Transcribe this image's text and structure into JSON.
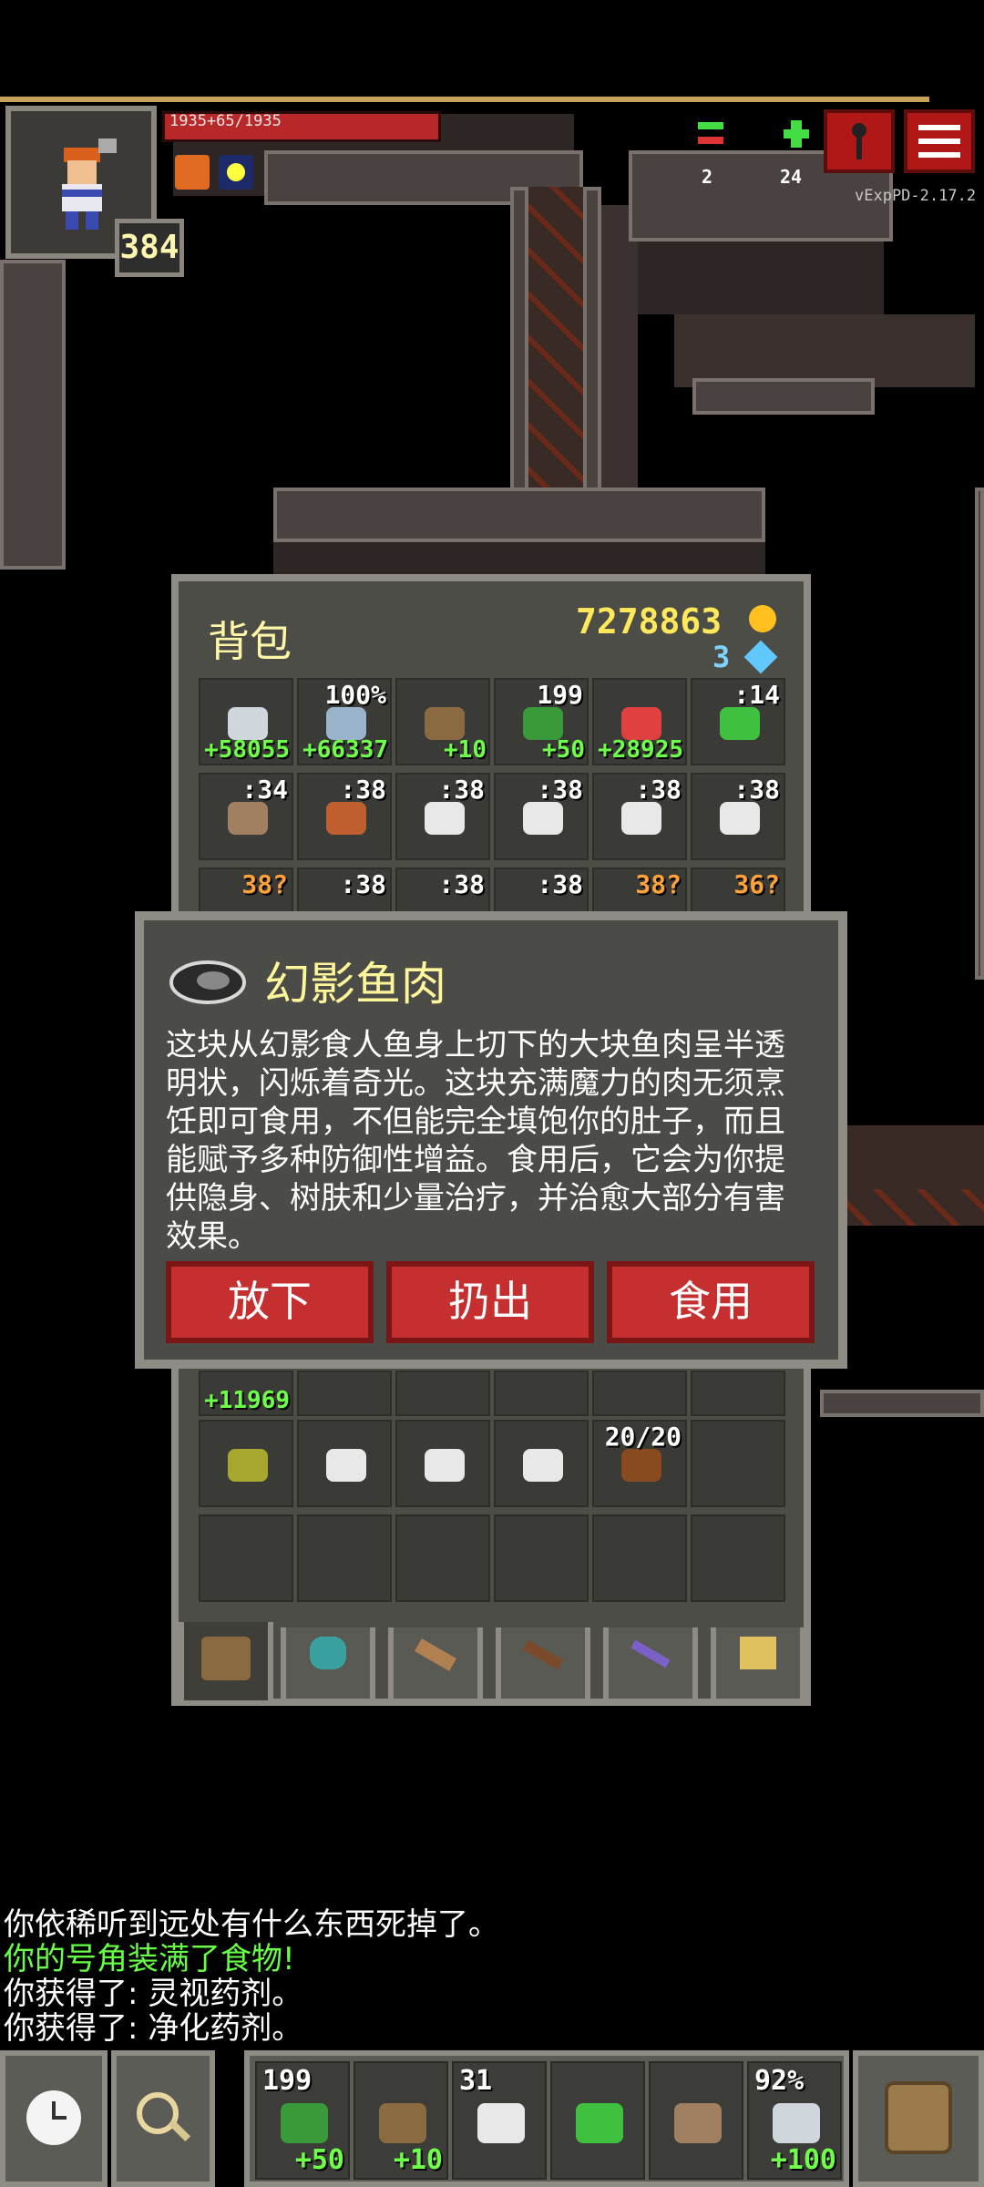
{
  "hud": {
    "hp_text": "1935+65/1935",
    "hp_fraction": 1.0,
    "level": "384",
    "journal_count": "2",
    "catalog_count": "24",
    "version": "vExpPD-2.17.2"
  },
  "inventory": {
    "title": "背包",
    "gold": "7278863",
    "gems": "3",
    "row1": [
      {
        "plus": "+58055",
        "icon": "sword-icon"
      },
      {
        "top": "100%",
        "plus": "+66337",
        "icon": "armor-icon"
      },
      {
        "plus": "+10",
        "icon": "spellbook-icon"
      },
      {
        "top": "199",
        "plus": "+50",
        "icon": "chain-whip-icon"
      },
      {
        "plus": "+28925",
        "icon": "ring-icon"
      },
      {
        "top": ":14",
        "icon": "wand-icon"
      }
    ],
    "row2": [
      {
        "top": ":34",
        "icon": "pickaxe-icon"
      },
      {
        "top": ":38",
        "icon": "staff-icon"
      },
      {
        "top": ":38",
        "icon": "potion-icon"
      },
      {
        "top": ":38",
        "icon": "potion-icon"
      },
      {
        "top": ":38",
        "icon": "potion-icon"
      },
      {
        "top": ":38",
        "icon": "potion-icon"
      }
    ],
    "row3": [
      {
        "q": "38?"
      },
      {
        "top": ":38"
      },
      {
        "top": ":38"
      },
      {
        "top": ":38"
      },
      {
        "q": "38?"
      },
      {
        "q": "36?"
      }
    ],
    "row4_plus": "+11969",
    "row5": [
      {
        "icon": "seed-pouch-icon"
      },
      {
        "icon": "fish-meat-icon"
      },
      {
        "icon": "fish-meat-icon"
      },
      {
        "icon": "fish-meat-icon"
      },
      {
        "top": "20/20",
        "icon": "horn-icon"
      }
    ]
  },
  "dialog": {
    "title": "幻影鱼肉",
    "description": "这块从幻影食人鱼身上切下的大块鱼肉呈半透明状，闪烁着奇光。这块充满魔力的肉无须烹饪即可食用，不但能完全填饱你的肚子，而且能赋予多种防御性增益。食用后，它会为你提供隐身、树肤和少量治疗，并治愈大部分有害效果。",
    "buttons": {
      "drop": "放下",
      "throw": "扔出",
      "eat": "食用"
    }
  },
  "log": [
    {
      "text": "你依稀听到远处有什么东西死掉了。",
      "color": "#ffffff"
    },
    {
      "text": "你的号角装满了食物!",
      "color": "#66ff44"
    },
    {
      "text": "你获得了: 灵视药剂。",
      "color": "#ffffff"
    },
    {
      "text": "你获得了: 净化药剂。",
      "color": "#ffffff"
    }
  ],
  "toolbar": {
    "quickslots": [
      {
        "top": "199",
        "plus": "+50",
        "icon": "chain-whip-icon"
      },
      {
        "plus": "+10",
        "icon": "spellbook-icon"
      },
      {
        "top": "31",
        "icon": "fish-meat-icon"
      },
      {
        "icon": "wand-icon"
      },
      {
        "icon": "pickaxe-icon"
      },
      {
        "top": "92%",
        "plus": "+100",
        "icon": "sword-icon"
      }
    ]
  },
  "colors": {
    "accent_red": "#c52f2f",
    "title_yellow": "#fff59a",
    "plus_green": "#6eff4a"
  }
}
